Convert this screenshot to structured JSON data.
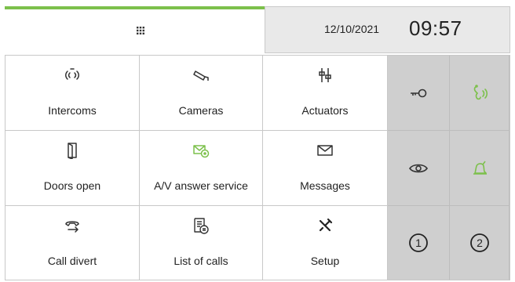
{
  "header": {
    "date": "12/10/2021",
    "time": "09:57"
  },
  "menu": [
    {
      "label": "Intercoms"
    },
    {
      "label": "Cameras"
    },
    {
      "label": "Actuators"
    },
    {
      "label": "Doors open"
    },
    {
      "label": "A/V answer service"
    },
    {
      "label": "Messages"
    },
    {
      "label": "Call divert"
    },
    {
      "label": "List of calls"
    },
    {
      "label": "Setup"
    }
  ],
  "side_buttons": [
    {
      "icon": "key-icon"
    },
    {
      "icon": "voice-call-icon"
    },
    {
      "icon": "eye-icon"
    },
    {
      "icon": "bell-icon"
    },
    {
      "label": "1"
    },
    {
      "label": "2"
    }
  ],
  "colors": {
    "accent": "#7cc04b",
    "panel_gray": "#cfcfcf",
    "header_gray": "#e9e9e9"
  }
}
